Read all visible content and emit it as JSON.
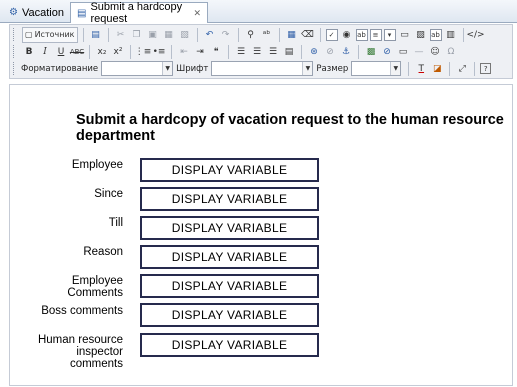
{
  "tabs": [
    {
      "label": "Vacation",
      "icon": "diagram-icon",
      "active": false
    },
    {
      "label": "Submit a hardcopy request",
      "icon": "form-icon",
      "active": true,
      "closable": true
    }
  ],
  "toolbar": {
    "source_label": "Источник",
    "format_label": "Форматирование",
    "format_value": "",
    "font_label": "Шрифт",
    "font_value": "",
    "size_label": "Размер",
    "size_value": ""
  },
  "form": {
    "title": "Submit a hardcopy of vacation request to the human resource department",
    "fields": [
      {
        "label": "Employee",
        "value": "DISPLAY VARIABLE"
      },
      {
        "label": "Since",
        "value": "DISPLAY VARIABLE"
      },
      {
        "label": "Till",
        "value": "DISPLAY VARIABLE"
      },
      {
        "label": "Reason",
        "value": "DISPLAY VARIABLE"
      },
      {
        "label": "Employee Comments",
        "value": "DISPLAY VARIABLE"
      },
      {
        "label": "Boss comments",
        "value": "DISPLAY VARIABLE"
      },
      {
        "label": "Human resource inspector comments",
        "value": "DISPLAY VARIABLE"
      }
    ]
  }
}
